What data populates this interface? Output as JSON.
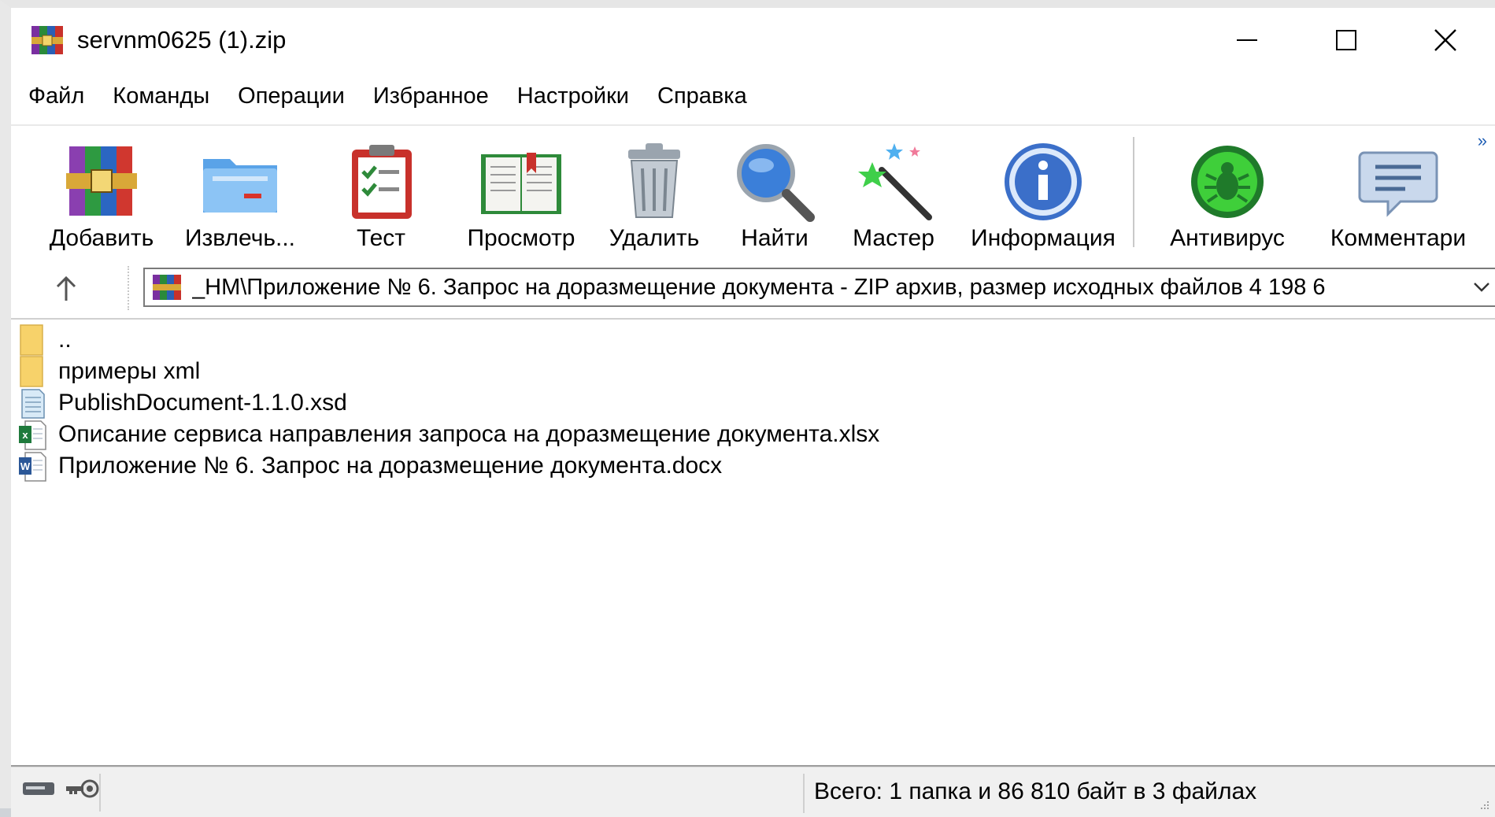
{
  "window": {
    "title": "servnm0625 (1).zip",
    "controls": [
      "minimize-icon",
      "maximize-icon",
      "close-icon"
    ]
  },
  "menu": {
    "items": [
      "Файл",
      "Команды",
      "Операции",
      "Избранное",
      "Настройки",
      "Справка"
    ]
  },
  "toolbar": {
    "buttons": [
      {
        "label": "Добавить",
        "icon": "add-archive-icon"
      },
      {
        "label": "Извлечь...",
        "icon": "extract-folder-icon"
      },
      {
        "label": "Тест",
        "icon": "test-clipboard-icon"
      },
      {
        "label": "Просмотр",
        "icon": "view-book-icon"
      },
      {
        "label": "Удалить",
        "icon": "delete-trash-icon"
      },
      {
        "label": "Найти",
        "icon": "find-magnifier-icon"
      },
      {
        "label": "Мастер",
        "icon": "wizard-wand-icon"
      },
      {
        "label": "Информация",
        "icon": "info-icon"
      },
      {
        "label": "Антивирус",
        "icon": "antivirus-bug-icon"
      },
      {
        "label": "Комментари",
        "icon": "comment-icon"
      }
    ],
    "overflow": "»"
  },
  "address": {
    "text": "_НМ\\Приложение № 6. Запрос на доразмещение документа - ZIP архив, размер исходных файлов 4 198 6"
  },
  "files": [
    {
      "name": "..",
      "icon": "folder-icon"
    },
    {
      "name": "примеры xml",
      "icon": "folder-icon"
    },
    {
      "name": "PublishDocument-1.1.0.xsd",
      "icon": "xsd-file-icon"
    },
    {
      "name": "Описание сервиса направления запроса на доразмещение документа.xlsx",
      "icon": "excel-file-icon"
    },
    {
      "name": "Приложение № 6. Запрос на доразмещение документа.docx",
      "icon": "word-file-icon"
    }
  ],
  "status": {
    "text": "Всего: 1 папка и 86 810 байт в 3 файлах"
  },
  "colors": {
    "accent_blue": "#1f5fb5",
    "folder_yellow": "#f7d26a",
    "excel_green": "#1f7a3c",
    "word_blue": "#2b5797"
  }
}
